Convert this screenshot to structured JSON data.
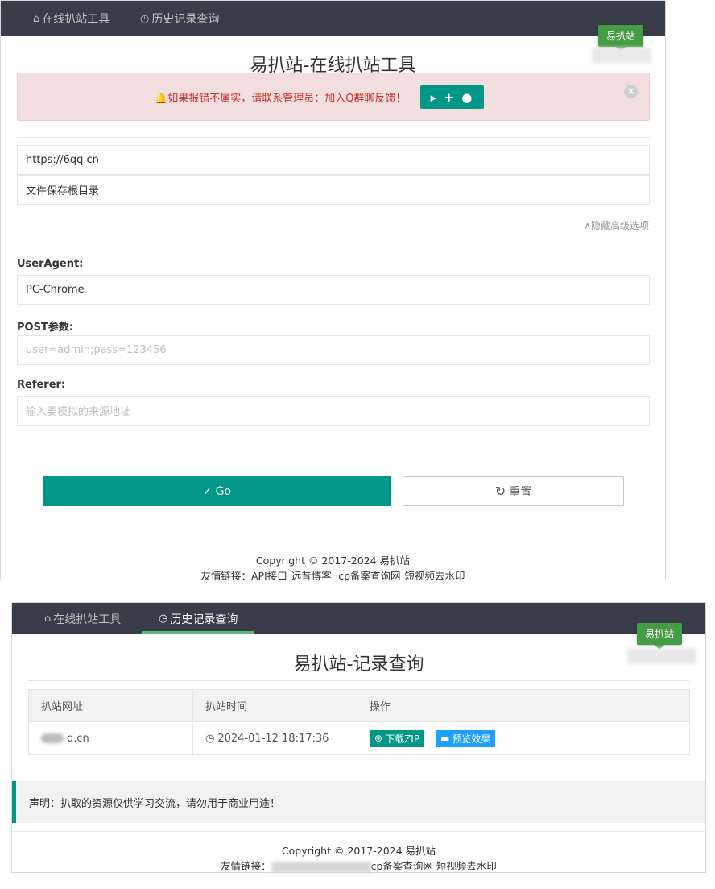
{
  "nav": {
    "tool": {
      "icon": "home-icon",
      "label": "在线扒站工具"
    },
    "history": {
      "icon": "clock-icon",
      "label": "历史记录查询"
    }
  },
  "site_tag": "易扒站",
  "tool_page": {
    "title": "易扒站-在线扒站工具",
    "alert": {
      "icon": "bell-icon",
      "text": "如果报错不属实，请联系管理员：加入Q群聊反馈！",
      "qq_button_label": "▸ + ●",
      "close_icon": "close-circle-icon"
    },
    "url_input_value": "https://6qq.cn",
    "dir_input_value": "文件保存根目录",
    "advanced_toggle": "∧隐藏高级选项",
    "useragent": {
      "label": "UserAgent:",
      "value": "PC-Chrome"
    },
    "post": {
      "label": "POST参数:",
      "placeholder": "user=admin;pass=123456"
    },
    "referer": {
      "label": "Referer:",
      "placeholder": "输入要模拟的来源地址"
    },
    "go_button": {
      "icon": "check-icon",
      "label": "Go"
    },
    "reset_button": {
      "icon": "refresh-icon",
      "label": "重置"
    },
    "footer": {
      "copyright": "Copyright © 2017-2024 易扒站",
      "links_label": "友情链接：",
      "links": [
        "API接口",
        "远昔博客",
        "icp备案查询网",
        "短视频去水印"
      ]
    }
  },
  "history_page": {
    "title": "易扒站-记录查询",
    "table": {
      "headers": [
        "扒站网址",
        "扒站时间",
        "操作"
      ],
      "rows": [
        {
          "url": "q.cn",
          "time": "2024-01-12 18:17:36",
          "download_label": "下载ZIP",
          "preview_label": "预览效果"
        }
      ]
    },
    "notice": "声明：扒取的资源仅供学习交流，请勿用于商业用途！",
    "footer": {
      "copyright": "Copyright © 2017-2024 易扒站",
      "links_label": "友情链接：",
      "visible_links": "cp备案查询网 短视频去水印"
    }
  }
}
